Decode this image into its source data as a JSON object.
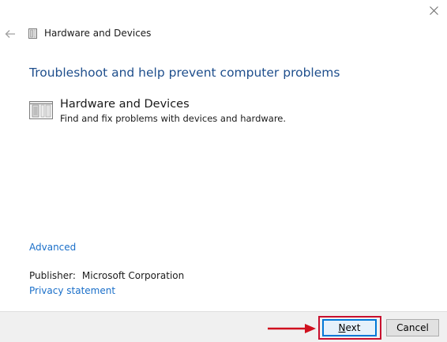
{
  "window": {
    "title": "Hardware and Devices"
  },
  "heading": "Troubleshoot and help prevent computer problems",
  "troubleshooter": {
    "title": "Hardware and Devices",
    "description": "Find and fix problems with devices and hardware."
  },
  "links": {
    "advanced": "Advanced",
    "privacy": "Privacy statement"
  },
  "publisher": {
    "label": "Publisher:",
    "value": "Microsoft Corporation"
  },
  "buttons": {
    "next_first": "N",
    "next_rest": "ext",
    "cancel": "Cancel"
  },
  "colors": {
    "heading": "#1e4e8c",
    "link": "#1a6fc9",
    "highlight": "#c8102e",
    "footer_bg": "#f0f0f0"
  },
  "icons": {
    "close": "close-icon",
    "back": "back-arrow-icon",
    "title": "hardware-devices-icon",
    "item": "hardware-devices-icon",
    "annotation": "red-arrow-icon"
  }
}
